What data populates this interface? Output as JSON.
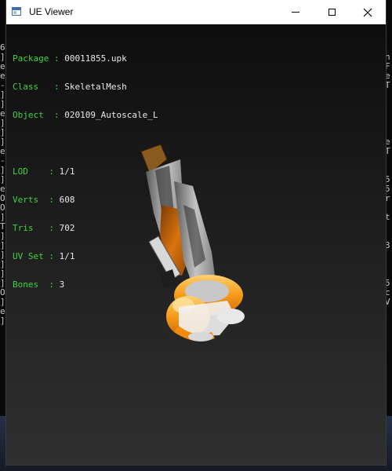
{
  "window": {
    "title": "UE Viewer"
  },
  "background_console": {
    "left_chars": [
      "6",
      "]",
      "e",
      "e",
      "-",
      "]",
      "]",
      "e",
      "]",
      "]",
      "]",
      "e",
      "-",
      "]",
      "]",
      "e",
      "O",
      "O",
      "]",
      "T",
      "]",
      "]",
      "]",
      "]",
      "]",
      "]",
      "O",
      "]",
      "e",
      "]"
    ],
    "right_chars": [
      "",
      "n",
      "F",
      "e",
      "T",
      "",
      "",
      "",
      "",
      "",
      "e",
      "T",
      "",
      "",
      "5",
      "5",
      "r",
      "",
      "t",
      "",
      "",
      "3",
      "",
      "",
      "",
      "5",
      "c",
      "V",
      "",
      ""
    ]
  },
  "info": {
    "package_label": "Package",
    "package_value": "00011855.upk",
    "class_label": "Class",
    "class_value": "SkeletalMesh",
    "object_label": "Object",
    "object_value": "020109_Autoscale_L",
    "lod_label": "LOD",
    "lod_value": "1/1",
    "verts_label": "Verts",
    "verts_value": "608",
    "tris_label": "Tris",
    "tris_value": "702",
    "uvset_label": "UV Set",
    "uvset_value": "1/1",
    "bones_label": "Bones",
    "bones_value": "3"
  },
  "colors": {
    "label_green": "#3fd23f",
    "value_white": "#e8e8e8",
    "mesh_orange": "#e07a10",
    "mesh_grey": "#b8b8b8"
  }
}
